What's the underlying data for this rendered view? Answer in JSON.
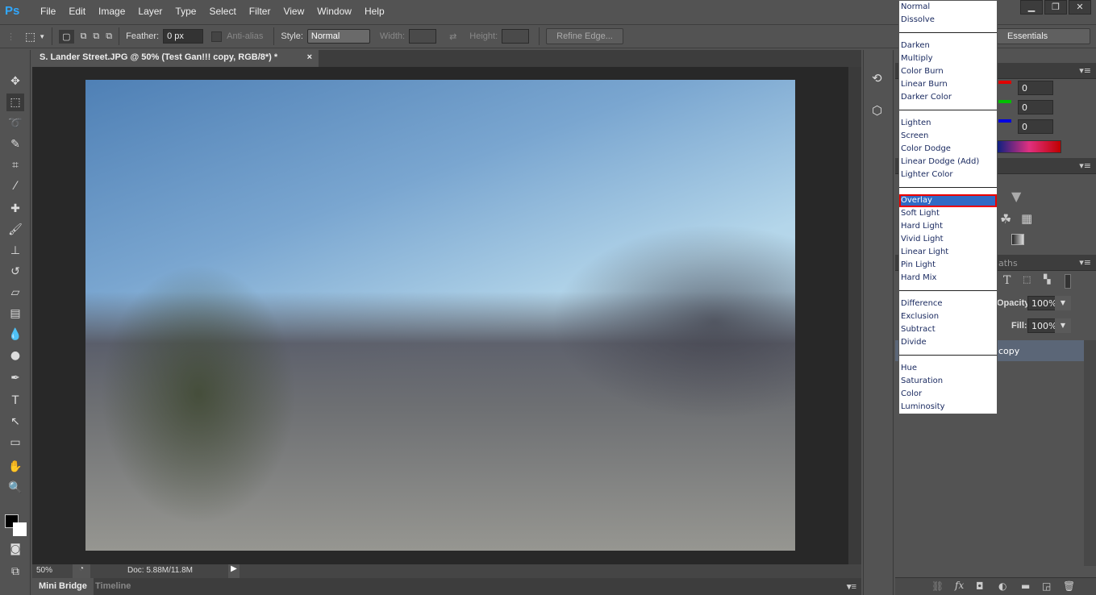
{
  "app": {
    "logo": "Ps",
    "menu": [
      "File",
      "Edit",
      "Image",
      "Layer",
      "Type",
      "Select",
      "Filter",
      "View",
      "Window",
      "Help"
    ],
    "window_controls": [
      "minimize",
      "restore",
      "close"
    ]
  },
  "options": {
    "feather_label": "Feather:",
    "feather_value": "0 px",
    "antialias_label": "Anti-alias",
    "style_label": "Style:",
    "style_value": "Normal",
    "width_label": "Width:",
    "height_label": "Height:",
    "refine_edge": "Refine Edge...",
    "workspace": "Essentials"
  },
  "document": {
    "tab_title": "S. Lander Street.JPG @ 50% (Test Gan!!! copy, RGB/8*) *",
    "close": "×"
  },
  "status": {
    "zoom": "50%",
    "doc": "Doc: 5.88M/11.8M"
  },
  "bottom_tabs": [
    "Mini Bridge",
    "Timeline"
  ],
  "color_panel": {
    "r": "0",
    "g": "0",
    "b": "0",
    "colors": {
      "r": "#e00000",
      "g": "#00c000",
      "b": "#0000e0"
    }
  },
  "layers": {
    "tab_partial": "aths",
    "opacity_label": "Opacity:",
    "opacity": "100%",
    "fill_label": "Fill:",
    "fill": "100%",
    "layer_name_partial": "copy"
  },
  "blend_modes": {
    "selected": "Overlay",
    "groups": [
      [
        "Normal",
        "Dissolve"
      ],
      [
        "Darken",
        "Multiply",
        "Color Burn",
        "Linear Burn",
        "Darker Color"
      ],
      [
        "Lighten",
        "Screen",
        "Color Dodge",
        "Linear Dodge (Add)",
        "Lighter Color"
      ],
      [
        "Overlay",
        "Soft Light",
        "Hard Light",
        "Vivid Light",
        "Linear Light",
        "Pin Light",
        "Hard Mix"
      ],
      [
        "Difference",
        "Exclusion",
        "Subtract",
        "Divide"
      ],
      [
        "Hue",
        "Saturation",
        "Color",
        "Luminosity"
      ]
    ]
  }
}
